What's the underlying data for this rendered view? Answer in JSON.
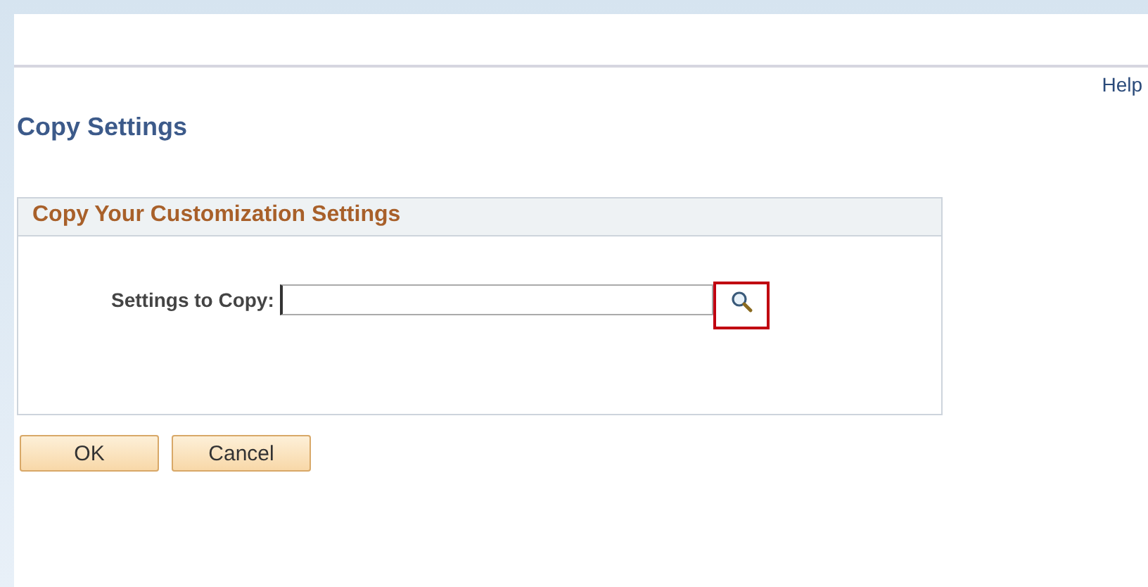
{
  "help_link": "Help",
  "page_title": "Copy Settings",
  "panel": {
    "title": "Copy Your Customization Settings",
    "field": {
      "label": "Settings to Copy:",
      "focused": true,
      "lookup_highlighted": true
    }
  },
  "buttons": [
    "OK",
    "Cancel"
  ]
}
